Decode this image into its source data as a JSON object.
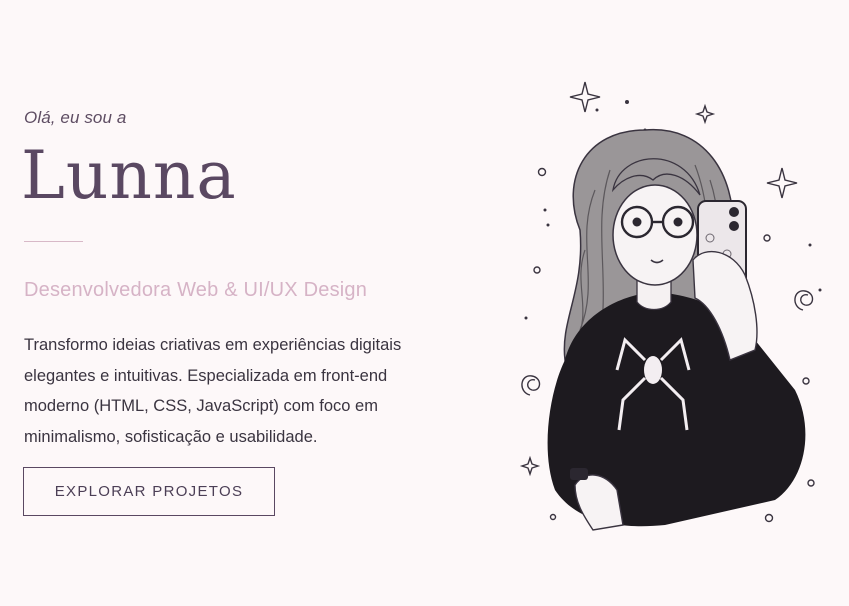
{
  "hero": {
    "greeting": "Olá, eu sou a",
    "name": "Lunna",
    "role": "Desenvolvedora Web & UI/UX Design",
    "description": "Transformo ideias criativas em experiências digitais elegantes e intuitivas. Especializada em front-end moderno (HTML, CSS, JavaScript) com foco em minimalismo, sofisticação e usabilidade.",
    "cta_label": "EXPLORAR PROJETOS"
  },
  "colors": {
    "background": "#fdf8f9",
    "name": "#5a4862",
    "role": "#d6b3c6",
    "body_text": "#3a3440",
    "divider": "#d8b9c8"
  },
  "illustration": {
    "icon": "portrait-illustration-icon"
  }
}
